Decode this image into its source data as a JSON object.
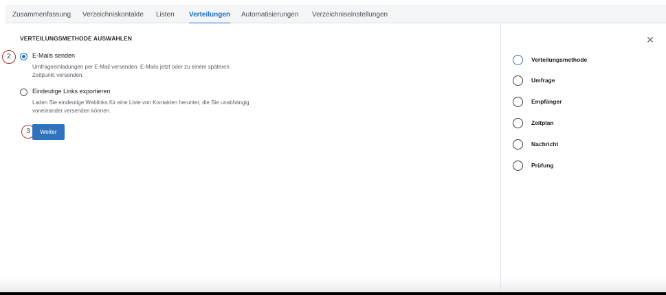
{
  "tabs": [
    {
      "label": "Zusammenfassung",
      "active": false
    },
    {
      "label": "Verzeichniskontakte",
      "active": false
    },
    {
      "label": "Listen",
      "active": false
    },
    {
      "label": "Verteilungen",
      "active": true
    },
    {
      "label": "Automatisierungen",
      "active": false
    },
    {
      "label": "Verzeichniseinstellungen",
      "active": false
    }
  ],
  "main": {
    "section_title": "VERTEILUNGSMETHODE AUSWÄHLEN",
    "options": [
      {
        "label": "E-Mails senden",
        "description": "Umfrageeinladungen per E-Mail versenden. E-Mails jetzt oder zu einem späteren Zeitpunkt versenden.",
        "selected": true
      },
      {
        "label": "Eindeutige Links exportieren",
        "description": "Laden Sie eindeutige Weblinks für eine Liste von Kontakten herunter, die Sie unabhängig voneinander versenden können.",
        "selected": false
      }
    ],
    "next_button": "Weiter",
    "step_badges": [
      "2",
      "3"
    ]
  },
  "panel": {
    "close_icon": "close-icon",
    "steps": [
      {
        "label": "Verteilungsmethode",
        "current": true
      },
      {
        "label": "Umfrage",
        "current": false
      },
      {
        "label": "Empfänger",
        "current": false
      },
      {
        "label": "Zeitplan",
        "current": false
      },
      {
        "label": "Nachricht",
        "current": false
      },
      {
        "label": "Prüfung",
        "current": false
      }
    ]
  },
  "colors": {
    "accent": "#2f73bf",
    "badge_border": "#b0302f"
  }
}
